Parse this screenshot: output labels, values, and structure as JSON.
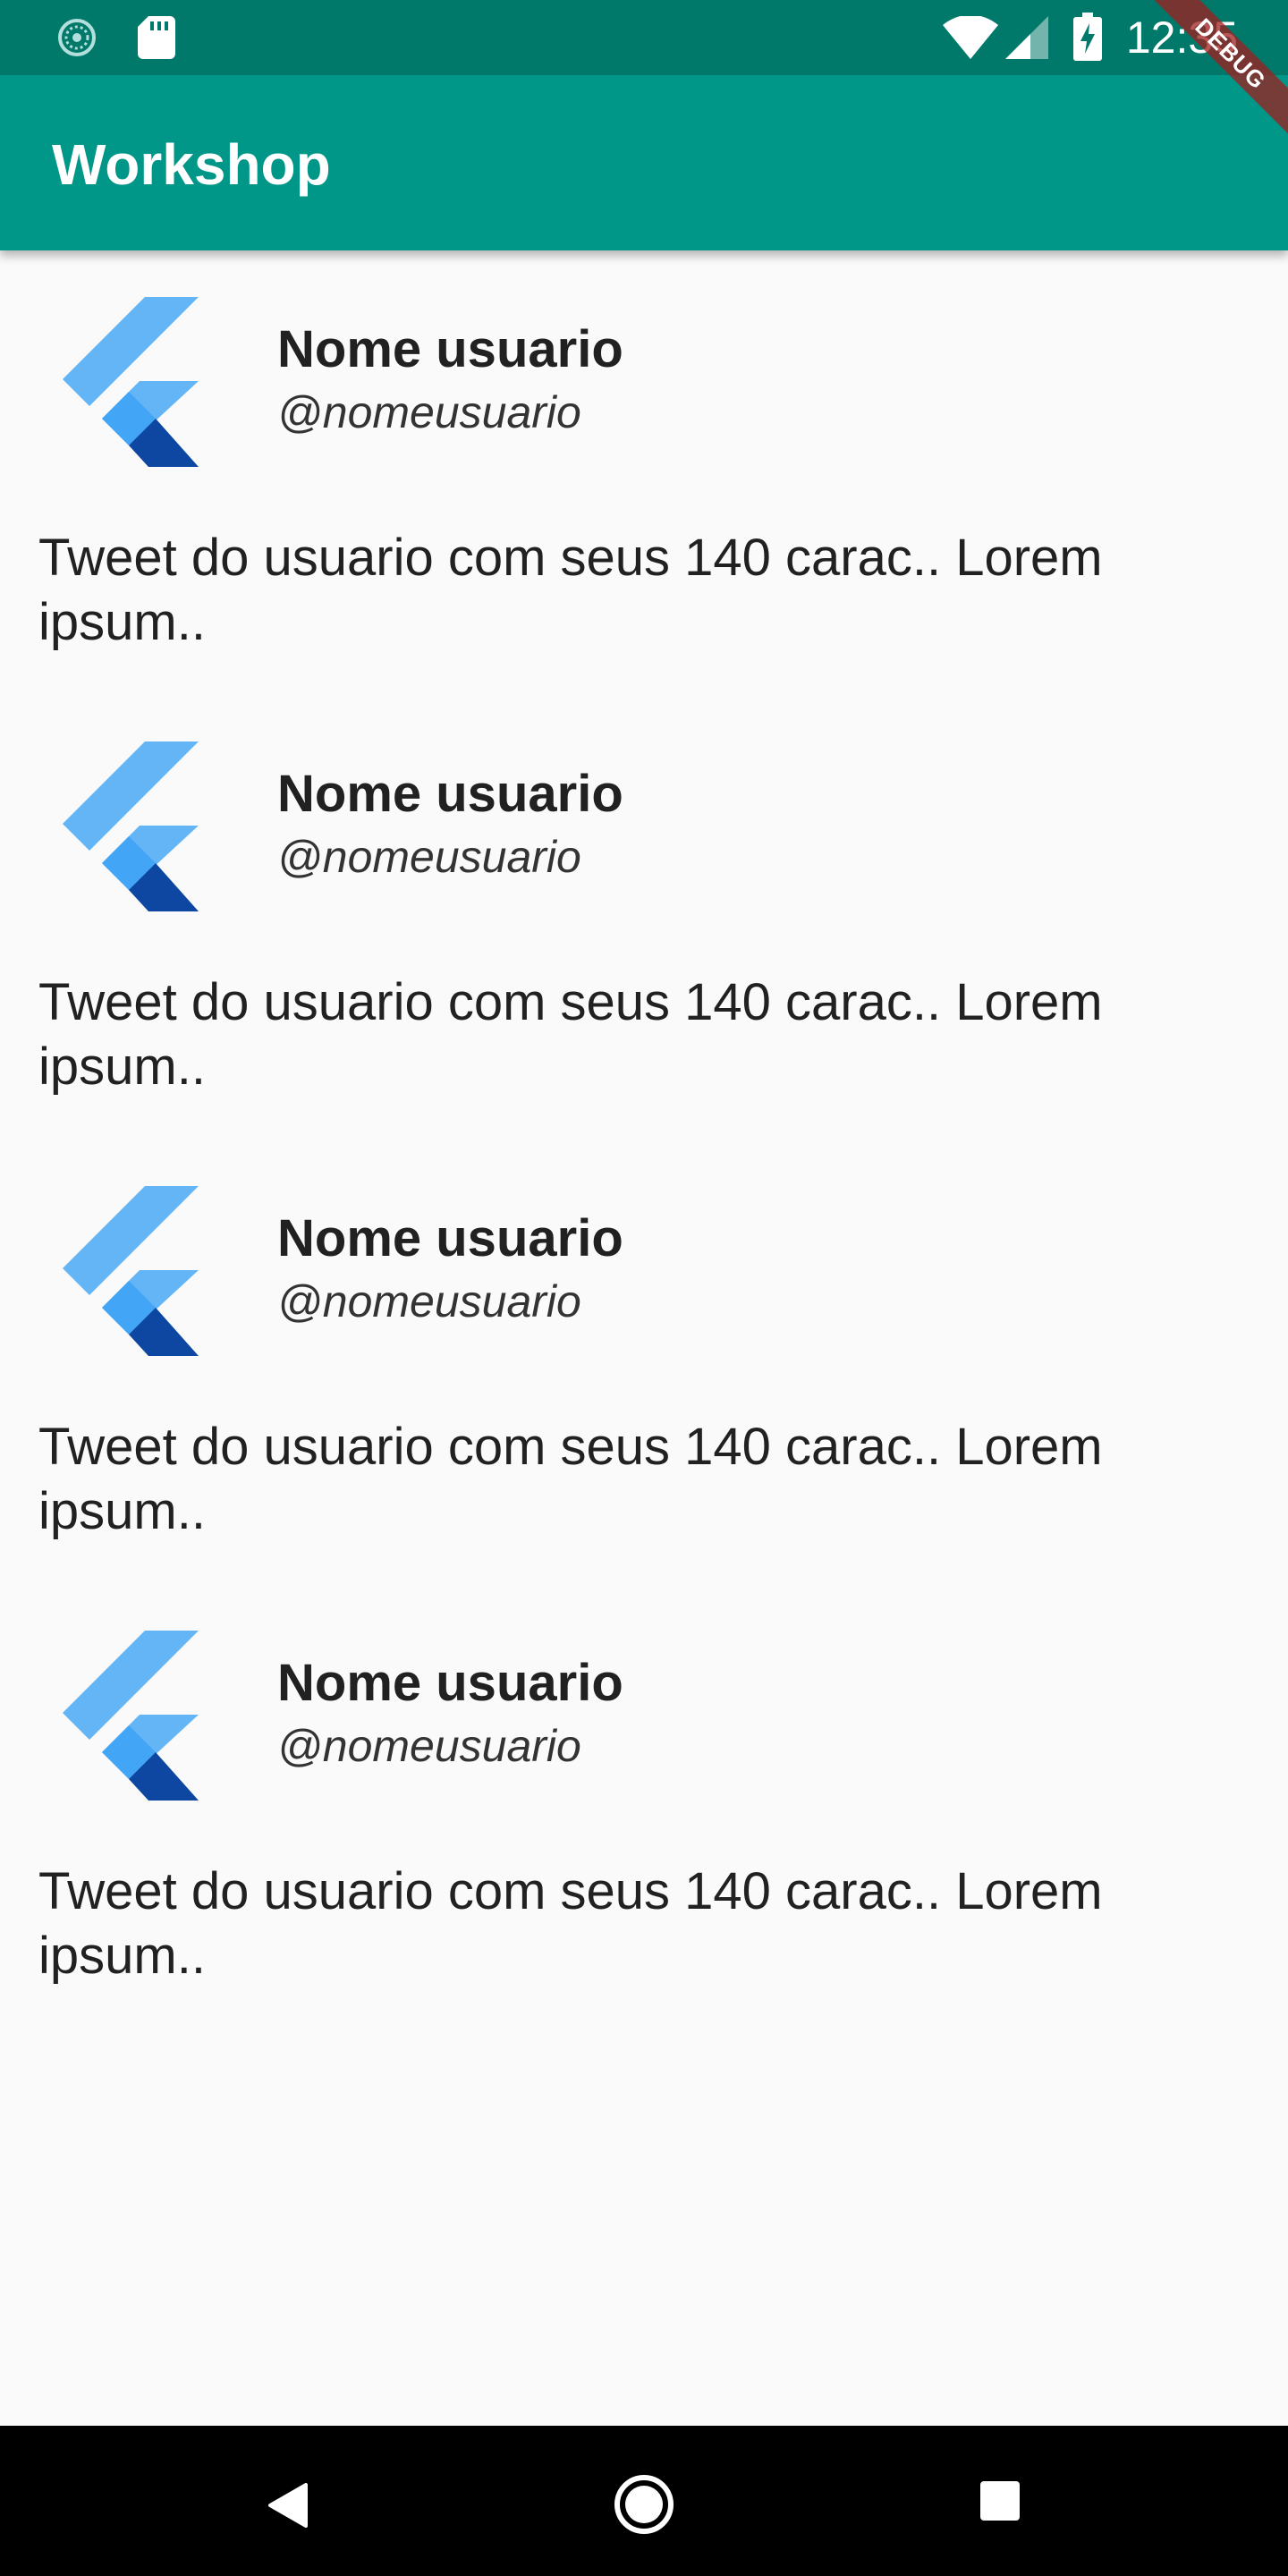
{
  "status_bar": {
    "time": "12:35",
    "icons": [
      "loading-icon",
      "sd-card-icon",
      "wifi-icon",
      "signal-icon",
      "battery-charging-icon"
    ]
  },
  "debug_banner": "DEBUG",
  "app_bar": {
    "title": "Workshop"
  },
  "tweets": [
    {
      "name": "Nome usuario",
      "handle": "@nomeusuario",
      "text": "Tweet do usuario com seus 140 carac.. Lorem ipsum..",
      "avatar": "flutter-logo-icon"
    },
    {
      "name": "Nome usuario",
      "handle": "@nomeusuario",
      "text": "Tweet do usuario com seus 140 carac.. Lorem ipsum..",
      "avatar": "flutter-logo-icon"
    },
    {
      "name": "Nome usuario",
      "handle": "@nomeusuario",
      "text": "Tweet do usuario com seus 140 carac.. Lorem ipsum..",
      "avatar": "flutter-logo-icon"
    },
    {
      "name": "Nome usuario",
      "handle": "@nomeusuario",
      "text": "Tweet do usuario com seus 140 carac.. Lorem ipsum..",
      "avatar": "flutter-logo-icon"
    }
  ],
  "nav_bar": {
    "buttons": [
      "back-icon",
      "home-icon",
      "recents-icon"
    ]
  },
  "colors": {
    "status_bar": "#00796b",
    "app_bar": "#009688",
    "background": "#fafafa",
    "flutter_light": "#64b5f6",
    "flutter_mid": "#42a5f5",
    "flutter_dark": "#0d47a1"
  }
}
